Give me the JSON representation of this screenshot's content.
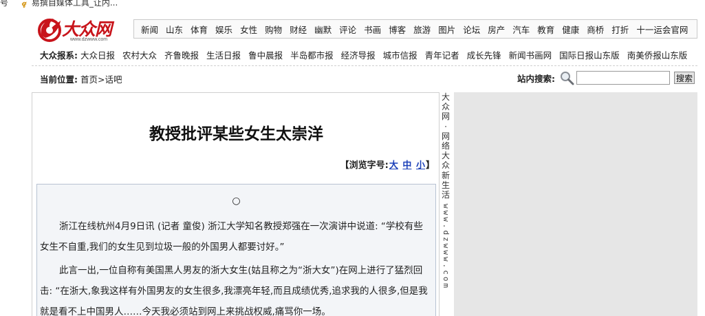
{
  "bookmarks": {
    "left_fragment": "号",
    "item_label": "易撰自媒体工具_让内..."
  },
  "logo": {
    "name": "大众网",
    "url_text": "www.dzwww.com",
    "brand_color": "#c8141b"
  },
  "topnav": [
    "新闻",
    "山东",
    "体育",
    "娱乐",
    "女性",
    "购物",
    "财经",
    "幽默",
    "评论",
    "书画",
    "博客",
    "旅游",
    "图片",
    "论坛",
    "房产",
    "汽车",
    "教育",
    "健康",
    "商桥",
    "打折",
    "十一运会官网"
  ],
  "press": {
    "label": "大众报系:",
    "items": [
      "大众日报",
      "农村大众",
      "齐鲁晚报",
      "生活日报",
      "鲁中晨报",
      "半岛都市报",
      "经济导报",
      "城市信报",
      "青年记者",
      "成长先锋",
      "新闻书画网",
      "国际日报山东版",
      "南美侨报山东版"
    ]
  },
  "breadcrumb": {
    "label": "当前位置:",
    "home": "首页",
    "separator": ">",
    "current": "话吧"
  },
  "search": {
    "label": "站内搜索:",
    "value": "",
    "button": "搜索"
  },
  "article": {
    "title": "教授批评某些女生太崇洋",
    "font_size": {
      "open": "【浏览字号:",
      "large": "大",
      "medium": "中",
      "small": "小",
      "close": "】"
    },
    "circle": "○",
    "paragraphs": [
      "浙江在线杭州4月9日讯 (记者 童俊) 浙江大学知名教授郑强在一次演讲中说道: “学校有些女生不自重,我们的女生见到垃圾一般的外国男人都要讨好。”",
      "此言一出,一位自称有美国黑人男友的浙大女生(姑且称之为“浙大女”)在网上进行了猛烈回击: “在浙大,象我这样有外国男友的女生很多,我漂亮年轻,而且成绩优秀,追求我的人很多,但是我就是看不上中国男人……今天我必须站到网上来挑战权威,痛骂你一场。"
    ]
  },
  "vertical_banner": {
    "cn": "大众网·网络大众新生活",
    "url": "www.dzwww.com"
  }
}
